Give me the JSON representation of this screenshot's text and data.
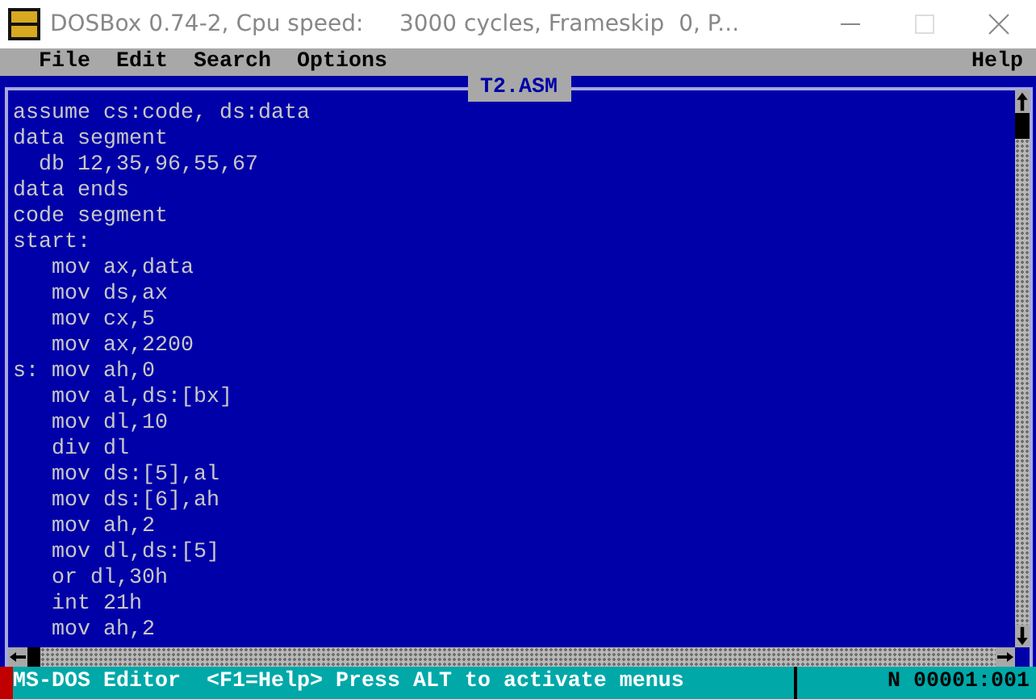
{
  "window": {
    "title": "DOSBox 0.74-2, Cpu speed:     3000 cycles, Frameskip  0, P..."
  },
  "menu": {
    "items": [
      "File",
      "Edit",
      "Search",
      "Options"
    ],
    "help": "Help"
  },
  "document": {
    "title": "T2.ASM",
    "lines": [
      "assume cs:code, ds:data",
      "data segment",
      "  db 12,35,96,55,67",
      "data ends",
      "code segment",
      "start:",
      "   mov ax,data",
      "   mov ds,ax",
      "   mov cx,5",
      "   mov ax,2200",
      "s: mov ah,0",
      "   mov al,ds:[bx]",
      "   mov dl,10",
      "   div dl",
      "   mov ds:[5],al",
      "   mov ds:[6],ah",
      "   mov ah,2",
      "   mov dl,ds:[5]",
      "   or dl,30h",
      "   int 21h",
      "   mov ah,2"
    ]
  },
  "status_bar": {
    "program": "MS-DOS Editor",
    "hint": "<F1=Help> Press ALT to activate menus",
    "position": "N 00001:001"
  }
}
